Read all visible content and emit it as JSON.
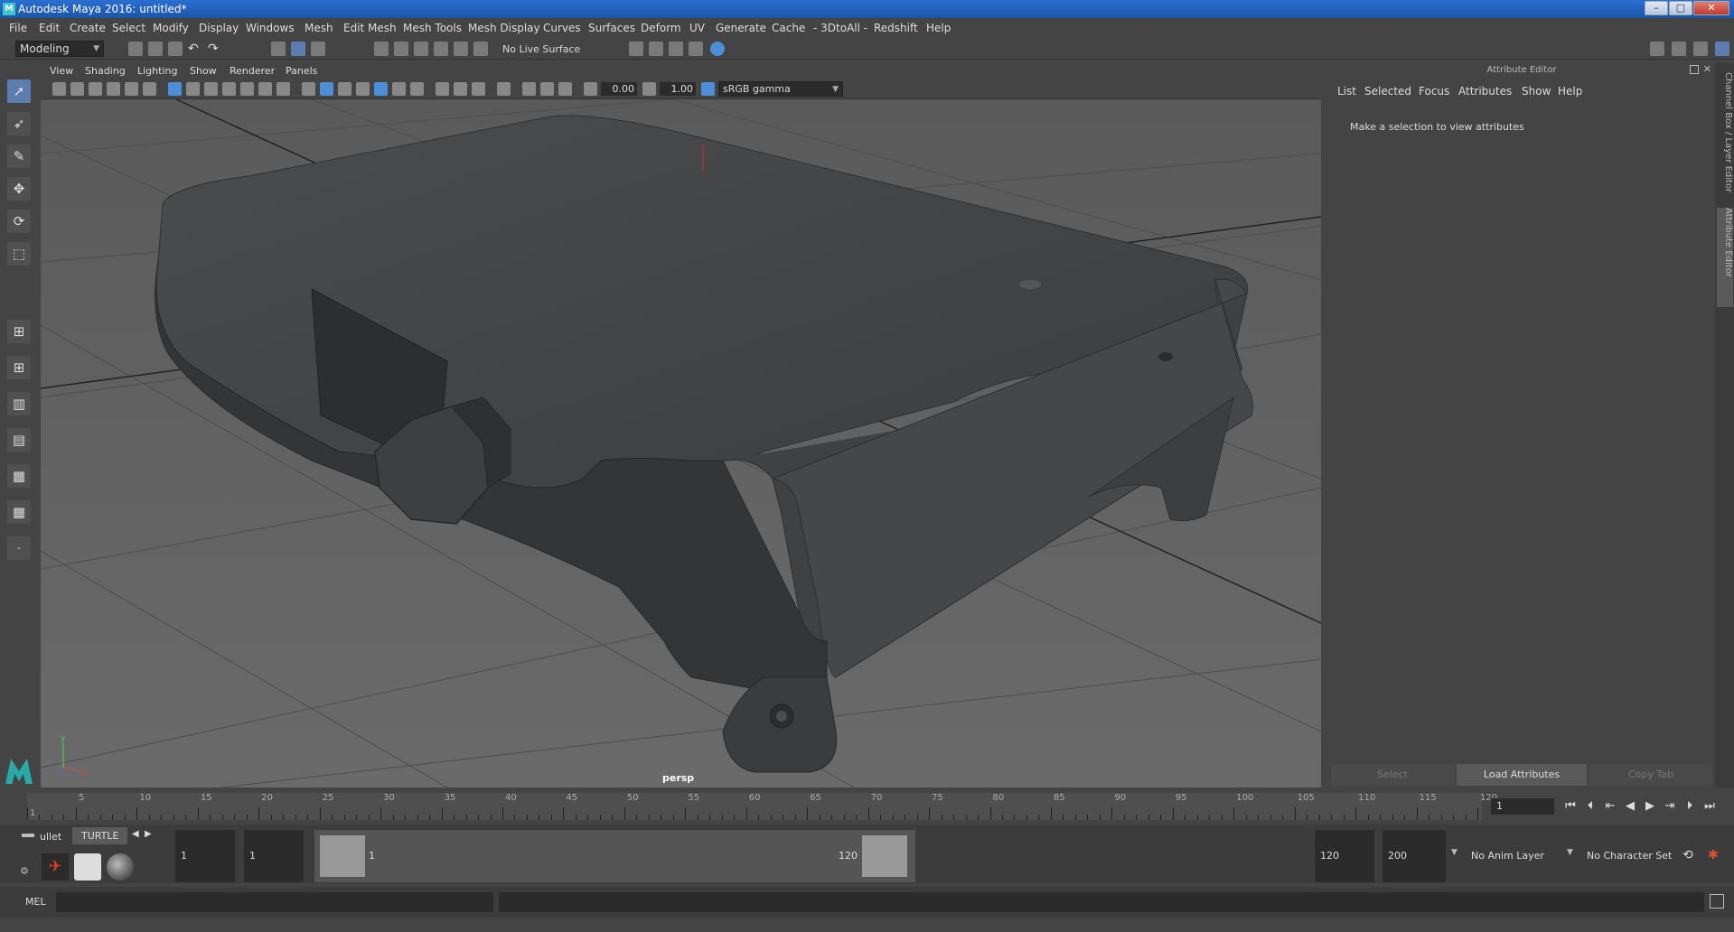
{
  "window": {
    "title": "Autodesk Maya 2016: untitled*"
  },
  "menu": [
    "File",
    "Edit",
    "Create",
    "Select",
    "Modify",
    "Display",
    "Windows",
    "Mesh",
    "Edit Mesh",
    "Mesh Tools",
    "Mesh Display",
    "Curves",
    "Surfaces",
    "Deform",
    "UV",
    "Generate",
    "Cache",
    "- 3DtoAll -",
    "Redshift",
    "Help"
  ],
  "shelf": {
    "mode": "Modeling",
    "live_surface": "No Live Surface"
  },
  "viewport": {
    "menu": [
      "View",
      "Shading",
      "Lighting",
      "Show",
      "Renderer",
      "Panels"
    ],
    "exposure": "0.00",
    "gamma": "1.00",
    "color_space": "sRGB gamma",
    "camera_label": "persp"
  },
  "attribute_editor": {
    "title": "Attribute Editor",
    "tabs": [
      "List",
      "Selected",
      "Focus",
      "Attributes",
      "Show",
      "Help"
    ],
    "message": "Make a selection to view attributes",
    "buttons": {
      "select": "Select",
      "load": "Load Attributes",
      "copy": "Copy Tab"
    }
  },
  "side_tabs": {
    "channel_box": "Channel Box / Layer Editor",
    "attribute_editor": "Attribute Editor"
  },
  "timeline": {
    "ticks": [
      "1",
      "5",
      "10",
      "15",
      "20",
      "25",
      "30",
      "35",
      "40",
      "45",
      "50",
      "55",
      "60",
      "65",
      "70",
      "75",
      "80",
      "85",
      "90",
      "95",
      "100",
      "105",
      "110",
      "115",
      "120"
    ],
    "current_frame": "1"
  },
  "range": {
    "shelf_tabs": [
      "ullet",
      "TURTLE"
    ],
    "start": "1",
    "playback_start": "1",
    "slider_start": "1",
    "slider_end": "120",
    "playback_end": "120",
    "end": "200",
    "anim_layer": "No Anim Layer",
    "character_set": "No Character Set"
  },
  "command_line": {
    "label": "MEL"
  }
}
